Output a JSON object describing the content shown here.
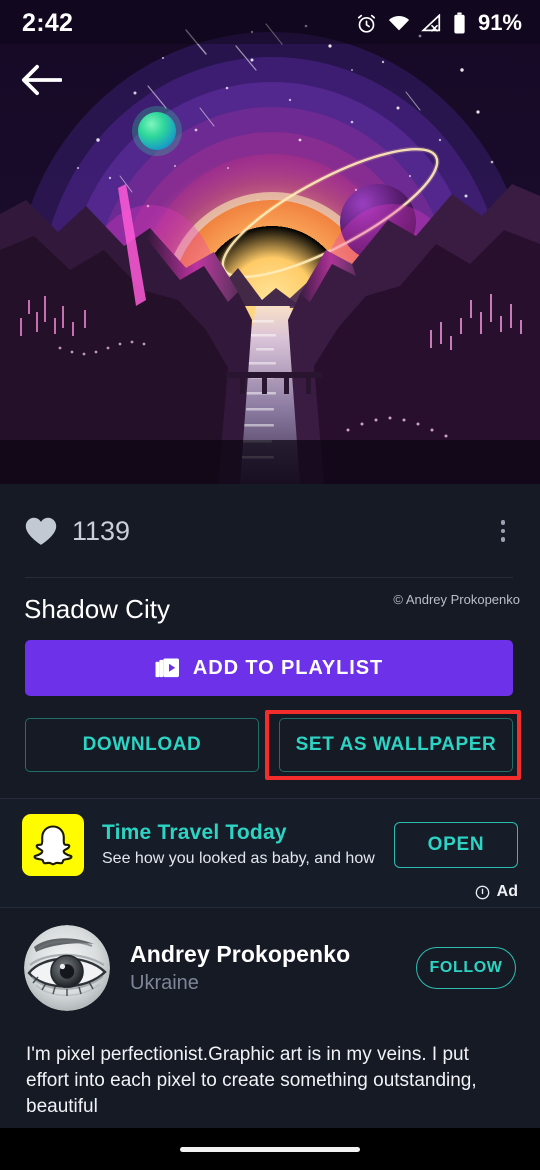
{
  "status_bar": {
    "time": "2:42",
    "battery_percent": "91%",
    "icons": [
      "alarm-icon",
      "wifi-icon",
      "cellular-off-icon",
      "battery-icon"
    ]
  },
  "artwork": {
    "name": "Shadow City",
    "description": "Synthwave retro illustration: glowing orange sun behind purple concentric arcs, green planet upper-left, dark ringed planet right, starfield, purple mountain canyon with reflective river and neon city lights",
    "palette": {
      "sun_core": "#ffcf6a",
      "sun_mid": "#f79a4f",
      "sun_glow": "#fff3b0",
      "arc_1": "#6f3fd4",
      "arc_2": "#8b3fb0",
      "arc_3": "#b3359a",
      "sky_deep": "#140a24",
      "green_planet": "#2fd89a",
      "ring_planet": "#5b1d73",
      "magenta_glow": "#e838c8",
      "mountain_dark": "#2a1430"
    }
  },
  "back_button": {
    "icon": "back-arrow-icon"
  },
  "likes": {
    "icon": "heart-icon",
    "count": "1139"
  },
  "overflow_menu": {
    "icon": "more-vertical-icon"
  },
  "title": {
    "text": "Shadow City",
    "copyright": "© Andrey Prokopenko"
  },
  "actions": {
    "playlist": {
      "label": "ADD TO PLAYLIST",
      "icon": "playlist-add-icon",
      "color": "#6c31e8"
    },
    "download": {
      "label": "DOWNLOAD",
      "color": "#2dd4c4"
    },
    "set_wallpaper": {
      "label": "SET AS WALLPAPER",
      "color": "#2dd4c4",
      "highlight_color": "#f42c2c",
      "highlighted": "true"
    }
  },
  "ad": {
    "icon": "snapchat-ghost-icon",
    "icon_background": "#fffc00",
    "title": "Time Travel Today",
    "description": "See how you looked as baby, and how y…",
    "cta_label": "OPEN",
    "label": "Ad",
    "label_icon": "ad-info-icon"
  },
  "author": {
    "avatar_icon": "eye-photo-avatar",
    "name": "Andrey Prokopenko",
    "country": "Ukraine",
    "follow_label": "FOLLOW",
    "bio": "I'm pixel perfectionist.Graphic art is in my veins. I put effort into each pixel to create something outstanding, beautiful"
  },
  "nav_bar": {
    "gesture_handle": "home-gesture-pill"
  },
  "theme": {
    "page_background": "#151a25",
    "accent_teal": "#2dd4c4",
    "accent_purple": "#6c31e8",
    "divider": "#262c3a"
  }
}
